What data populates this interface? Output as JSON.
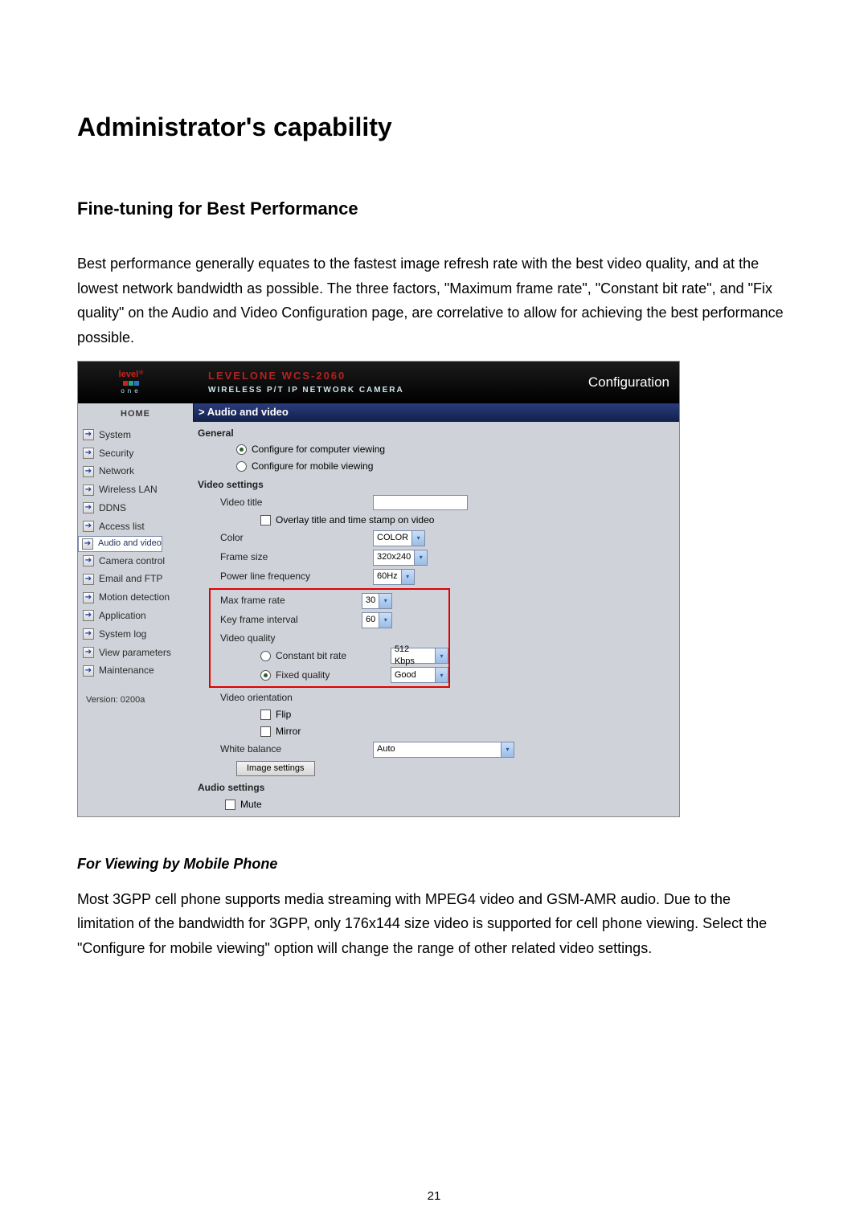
{
  "doc": {
    "heading": "Administrator's capability",
    "subheading": "Fine-tuning for Best Performance",
    "para1": "Best performance generally equates to the fastest image refresh rate with the best video quality, and at the lowest network bandwidth as possible. The three factors, \"Maximum frame rate\", \"Constant bit rate\", and \"Fix quality\" on the Audio and Video Configuration page, are correlative to allow for achieving the best performance possible.",
    "subhead2": "For Viewing by Mobile Phone",
    "para2": "Most 3GPP cell phone supports media streaming with MPEG4 video and GSM-AMR audio. Due to the limitation of the bandwidth for 3GPP, only 176x144 size video is supported for cell phone viewing. Select the \"Configure for mobile viewing\" option will change the range of other related video settings.",
    "page_number": "21"
  },
  "ui": {
    "brand_top": "level",
    "brand_bottom": "one",
    "device_title": "LEVELONE WCS-2060",
    "device_subtitle": "WIRELESS P/T IP NETWORK CAMERA",
    "config_link": "Configuration",
    "sidebar": {
      "home": "HOME",
      "items": [
        "System",
        "Security",
        "Network",
        "Wireless LAN",
        "DDNS",
        "Access list",
        "Audio and video",
        "Camera control",
        "Email and FTP",
        "Motion detection",
        "Application",
        "System log",
        "View parameters",
        "Maintenance"
      ],
      "version_label": "Version: 0200a"
    },
    "main": {
      "breadcrumb": "> Audio and video",
      "general_title": "General",
      "general": {
        "opt_computer": "Configure for computer viewing",
        "opt_mobile": "Configure for mobile viewing"
      },
      "video_title": "Video settings",
      "video": {
        "title_label": "Video title",
        "title_value": "",
        "overlay_label": "Overlay title and time stamp on video",
        "color_label": "Color",
        "color_value": "COLOR",
        "frame_size_label": "Frame size",
        "frame_size_value": "320x240",
        "plf_label": "Power line frequency",
        "plf_value": "60Hz",
        "max_fr_label": "Max frame rate",
        "max_fr_value": "30",
        "kfi_label": "Key frame interval",
        "kfi_value": "60",
        "vq_label": "Video quality",
        "cbr_label": "Constant bit rate",
        "cbr_value": "512 Kbps",
        "fq_label": "Fixed quality",
        "fq_value": "Good",
        "orient_label": "Video orientation",
        "flip_label": "Flip",
        "mirror_label": "Mirror",
        "wb_label": "White balance",
        "wb_value": "Auto",
        "img_settings_btn": "Image settings"
      },
      "audio_title": "Audio settings",
      "audio": {
        "mute_label": "Mute"
      }
    }
  }
}
